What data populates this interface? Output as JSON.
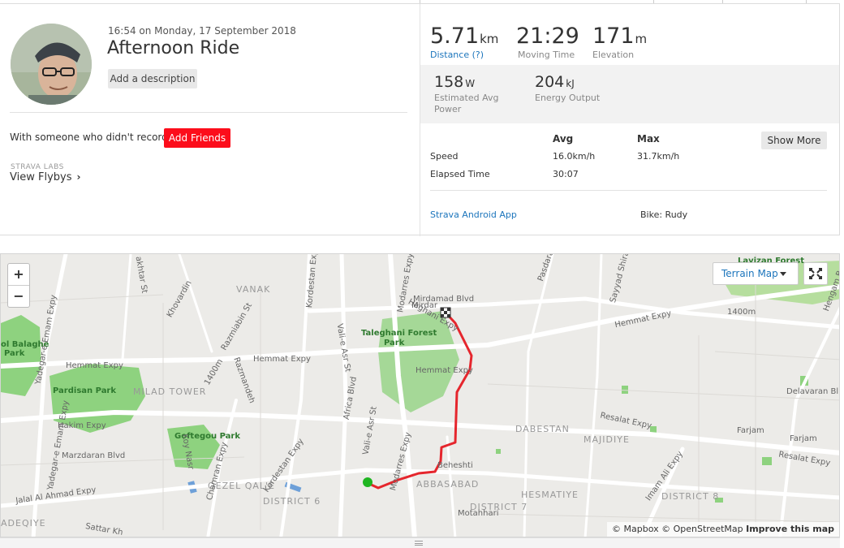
{
  "activity": {
    "datetime": "16:54 on Monday, 17 September 2018",
    "title": "Afternoon Ride",
    "add_description": "Add a description",
    "with_someone": "With someone who didn't record?",
    "add_friends": "Add Friends",
    "labs": "STRAVA LABS",
    "view_flybys": "View Flybys",
    "avatar_icon": "user-avatar"
  },
  "stats": {
    "distance": {
      "value": "5.71",
      "unit": "km",
      "label": "Distance (?)"
    },
    "moving_time": {
      "value": "21:29",
      "label": "Moving Time"
    },
    "elevation": {
      "value": "171",
      "unit": "m",
      "label": "Elevation"
    },
    "power": {
      "value": "158",
      "unit": "W",
      "label": "Estimated Avg Power"
    },
    "energy": {
      "value": "204",
      "unit": "kJ",
      "label": "Energy Output"
    }
  },
  "table": {
    "avg_header": "Avg",
    "max_header": "Max",
    "show_more": "Show More",
    "rows": [
      {
        "label": "Speed",
        "avg": "16.0km/h",
        "max": "31.7km/h"
      },
      {
        "label": "Elapsed Time",
        "avg": "30:07",
        "max": ""
      }
    ]
  },
  "footer": {
    "app": "Strava Android App",
    "bike": "Bike: Rudy"
  },
  "map": {
    "zoom_in": "+",
    "zoom_out": "−",
    "terrain": "Terrain Map",
    "attribution_prefix": "© Mapbox © OpenStreetMap",
    "attribution_link": "Improve this map",
    "route_color": "#e5262d",
    "start_color": "#1fb521",
    "labels": {
      "l1": "Mirdamad Blvd",
      "l2": "Mirdar",
      "l3": "Haghani Expy",
      "l4": "Taleghani Forest",
      "l5": "Park",
      "l6": "Hemmat Expy",
      "l7": "Hemmat Expy",
      "l8": "Hemmat Expy",
      "l9": "VANAK",
      "l10": "MILAD TOWER",
      "l11": "Pardisan Park",
      "l12": "Goftegou Park",
      "l13": "Hakim Expy",
      "l14": "Marzdaran Blvd",
      "l15": "Jalal Al Ahmad Expy",
      "l16": "Sattar Kh",
      "l17": "ADEQIYE",
      "l18": "QEZEL QAL'E",
      "l19": "DISTRICT 6",
      "l20": "DISTRICT 7",
      "l21": "ABBASABAD",
      "l22": "HESMATIYE",
      "l23": "DABESTAN",
      "l24": "MAJIDIYE",
      "l25": "DISTRICT 8",
      "l26": "Resalat Expy",
      "l27": "Resalat Expy",
      "l28": "Farjam",
      "l29": "Farjam",
      "l30": "Delavaran Bl",
      "l31": "Imam Ali Expy",
      "l32": "Beheshti",
      "l33": "Motahhari",
      "l34": "Modarres Expy",
      "l35": "Modarres Expy",
      "l36": "Africa Blvd",
      "l37": "Vali-e Asr St",
      "l38": "Kordestan Expy",
      "l39": "Kordestan Expy",
      "l40": "Chamran Expy",
      "l41": "Yadegar-e Emam Expy",
      "l42": "Yadegar-e Emam Expy",
      "l43": "Razmandeh",
      "l44": "Koy Nasr",
      "l45": "Sayyad Shiraz",
      "l46": "Pasdaran",
      "l47": "Lavizan Forest",
      "l48": "Hemmat Expy",
      "l49": "1400m",
      "l50": "Hengam B",
      "l51": "ol Balaghe",
      "l52": "Park",
      "l53": "Khovardin",
      "l54": "akhtar St",
      "l55": "1400m",
      "l56": "Razmiabin St",
      "l57": "Vali-e Asr St"
    }
  }
}
